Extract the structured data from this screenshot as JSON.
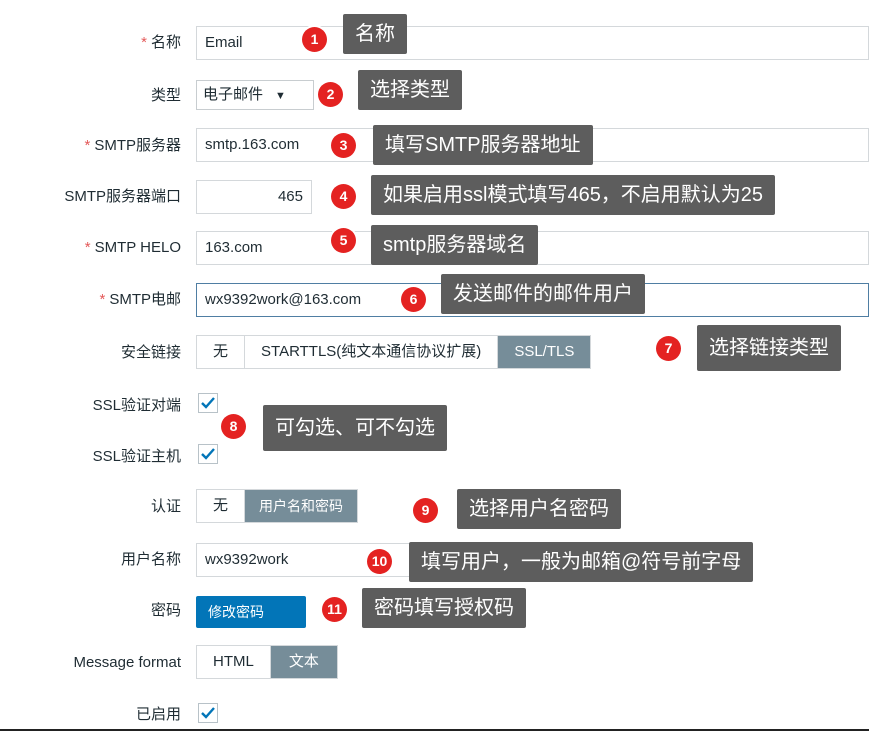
{
  "form": {
    "name": {
      "label": "名称",
      "value": "Email"
    },
    "type": {
      "label": "类型",
      "value": "电子邮件"
    },
    "smtp_server": {
      "label": "SMTP服务器",
      "value": "smtp.163.com"
    },
    "smtp_port": {
      "label": "SMTP服务器端口",
      "value": "465"
    },
    "smtp_helo": {
      "label": "SMTP HELO",
      "value": "163.com"
    },
    "smtp_email": {
      "label": "SMTP电邮",
      "value": "wx9392work@163.com"
    },
    "security": {
      "label": "安全链接",
      "options": [
        "无",
        "STARTTLS(纯文本通信协议扩展)",
        "SSL/TLS"
      ],
      "selected": "SSL/TLS"
    },
    "ssl_verify_peer": {
      "label": "SSL验证对端",
      "checked": true
    },
    "ssl_verify_host": {
      "label": "SSL验证主机",
      "checked": true
    },
    "auth": {
      "label": "认证",
      "options": [
        "无",
        "用户名和密码"
      ],
      "selected": "用户名和密码"
    },
    "username": {
      "label": "用户名称",
      "value": "wx9392work"
    },
    "password": {
      "label": "密码",
      "button": "修改密码"
    },
    "message_format": {
      "label": "Message format",
      "options": [
        "HTML",
        "文本"
      ],
      "selected": "文本"
    },
    "enabled": {
      "label": "已启用",
      "checked": true
    },
    "required_mark": "*"
  },
  "annotations": [
    {
      "num": "1",
      "text": "名称"
    },
    {
      "num": "2",
      "text": "选择类型"
    },
    {
      "num": "3",
      "text": "填写SMTP服务器地址"
    },
    {
      "num": "4",
      "text": "如果启用ssl模式填写465，不启用默认为25"
    },
    {
      "num": "5",
      "text": "smtp服务器域名"
    },
    {
      "num": "6",
      "text": "发送邮件的邮件用户"
    },
    {
      "num": "7",
      "text": "选择链接类型"
    },
    {
      "num": "8",
      "text": "可勾选、可不勾选"
    },
    {
      "num": "9",
      "text": "选择用户名密码"
    },
    {
      "num": "10",
      "text": "填写用户，一般为邮箱@符号前字母"
    },
    {
      "num": "11",
      "text": "密码填写授权码"
    }
  ],
  "colors": {
    "badge": "#e42221",
    "tip": "#5d5d5d",
    "selected_segment": "#768d99",
    "primary_button": "#0275b8",
    "required": "#e45959"
  }
}
